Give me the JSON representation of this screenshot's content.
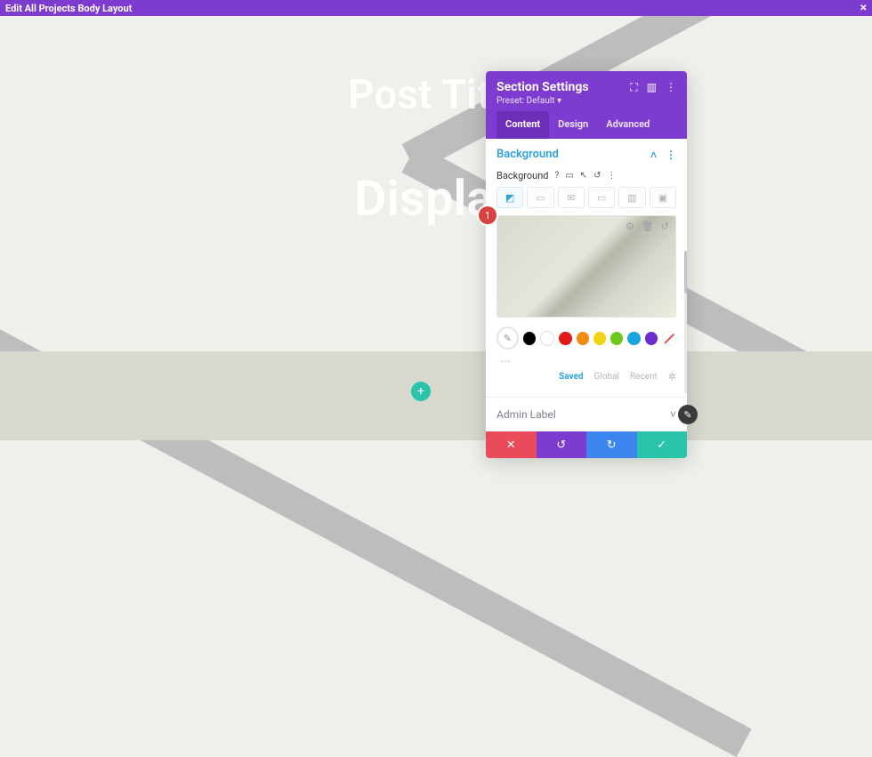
{
  "topbar": {
    "title": "Edit All Projects Body Layout",
    "close": "×"
  },
  "hero": {
    "line0": "",
    "line1": "Post Title",
    "line2": "Display"
  },
  "plus": "+",
  "panel": {
    "title": "Section Settings",
    "preset": "Preset: Default ▾",
    "head_icons": {
      "expand": "⛶",
      "columns": "▥",
      "more": "⋮"
    },
    "tabs": {
      "content": "Content",
      "design": "Design",
      "advanced": "Advanced"
    },
    "background": {
      "title": "Background",
      "collapse": "˄",
      "menu": "⋮",
      "label": "Background",
      "help": "?",
      "tablet": "▭",
      "hover": "↖",
      "reset": "↺",
      "more": "⋮",
      "bg_tabs": {
        "color": "◩",
        "gradient": "▭",
        "image": "✉",
        "video": "▭",
        "pattern": "▥",
        "mask": "▣"
      },
      "tools": {
        "gear": "⚙",
        "trash": "🗑",
        "revert": "↺"
      },
      "palette": {
        "picker": "✎",
        "swatches": [
          {
            "c": "#000000"
          },
          {
            "c": "#ffffff",
            "empty": true
          },
          {
            "c": "#e31919"
          },
          {
            "c": "#f08c0f"
          },
          {
            "c": "#f0d410"
          },
          {
            "c": "#6cc81b"
          },
          {
            "c": "#1aa3e0"
          },
          {
            "c": "#6b2ed1"
          },
          {
            "slash": true
          }
        ],
        "dots": "⋯",
        "tabs": {
          "saved": "Saved",
          "global": "Global",
          "recent": "Recent"
        },
        "gear": "✲"
      }
    },
    "admin_label": "Admin Label",
    "chev": "˅",
    "actions": {
      "close": "✕",
      "undo": "↺",
      "redo": "↻",
      "ok": "✓"
    }
  },
  "badge": "1",
  "corner": "✎"
}
